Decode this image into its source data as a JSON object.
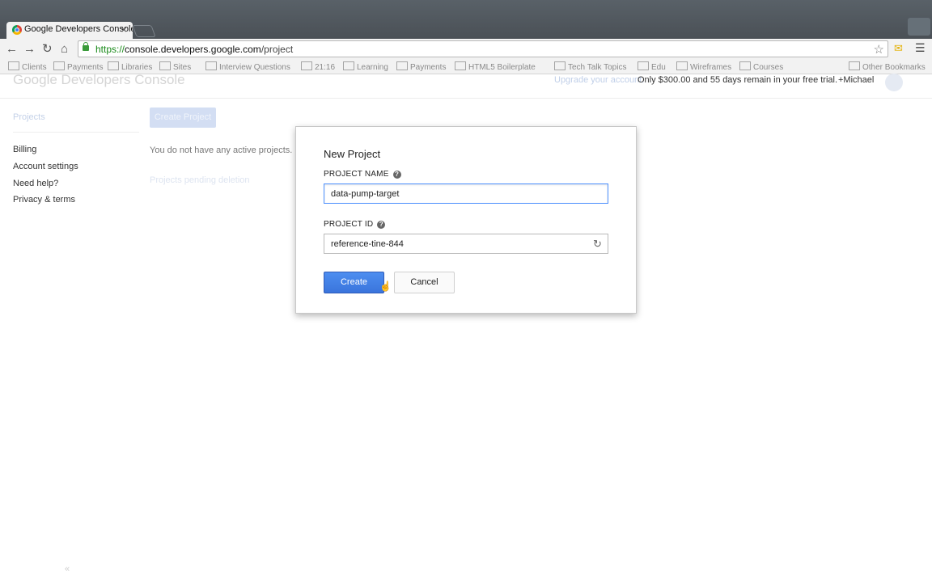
{
  "browser": {
    "tab_title": "Google Developers Console",
    "tab_close": "×",
    "url_scheme": "https://",
    "url_host": "console.developers.google.com",
    "url_path": "/project",
    "bookmarks": [
      "Clients",
      "Payments",
      "Libraries",
      "Sites",
      "Interview Questions",
      "21:16",
      "Learning",
      "Payments",
      "HTML5 Boilerplate",
      "Tech Talk Topics",
      "Edu",
      "Wireframes",
      "Courses",
      "Other Bookmarks"
    ],
    "icons": {
      "back": "back-arrow-icon",
      "forward": "forward-arrow-icon",
      "reload": "reload-icon",
      "home": "home-icon",
      "star": "star-icon",
      "menu": "hamburger-menu-icon"
    }
  },
  "header": {
    "logo": "Google Developers Console",
    "upgrade_link": "Upgrade your account.",
    "trial_text": "Only $300.00 and 55 days remain in your free trial.",
    "user": "+Michael"
  },
  "sidebar": {
    "projects": "Projects",
    "links": [
      "Billing",
      "Account settings",
      "Need help?",
      "Privacy & terms"
    ],
    "collapse": "«"
  },
  "main": {
    "create_project_label": "Create Project",
    "no_projects": "You do not have any active projects.",
    "pending_deletion": "Projects pending deletion"
  },
  "dialog": {
    "title": "New Project",
    "project_name_label": "PROJECT NAME",
    "project_name_value": "data-pump-target",
    "project_id_label": "PROJECT ID",
    "project_id_value": "reference-tine-844",
    "help_glyph": "?",
    "create_label": "Create",
    "cancel_label": "Cancel"
  }
}
